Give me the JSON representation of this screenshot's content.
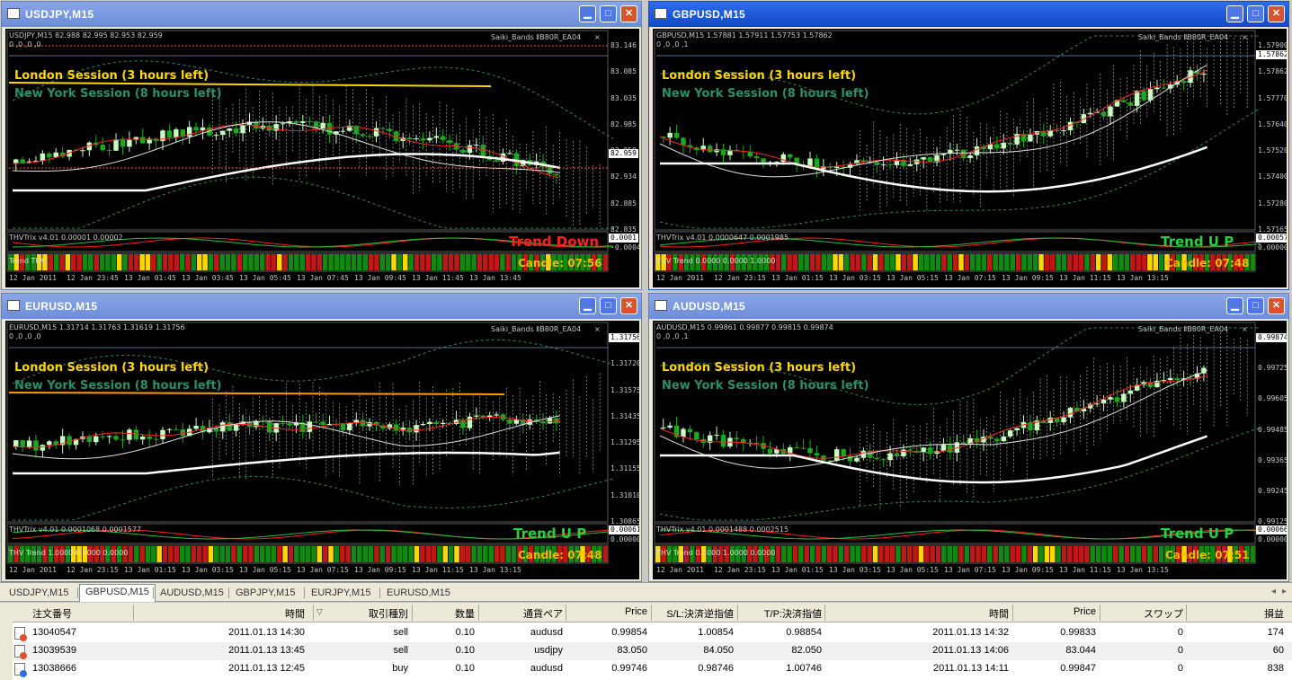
{
  "windows": [
    {
      "id": "usdjpy",
      "title": "USDJPY,M15",
      "active": false,
      "header": "USDJPY,M15  82.988 82.995 82.953 82.959",
      "sub": "0 ,0 ,0 ,0",
      "indicator": "Saiki_Bands ⅡB80R_EA04",
      "london": "London Session (3 hours left)",
      "newyork": "New York Session (8 hours left)",
      "prices": [
        "83.146",
        "83.085",
        "83.035",
        "82.985",
        "82.959",
        "82.934",
        "82.885",
        "82.835"
      ],
      "sub_indicator": "THVTrix v4.01 0.00001 0.00002",
      "sub_prices": [
        "0.0001",
        "-0.00047"
      ],
      "trend_label": "Trend THV",
      "trend": "Trend Down",
      "trend_color": "#ff2020",
      "candle": "Candle:  07:56",
      "times": [
        "12 Jan 2011",
        "12 Jan 23:45",
        "13 Jan 01:45",
        "13 Jan 03:45",
        "13 Jan 05:45",
        "13 Jan 07:45",
        "13 Jan 09:45",
        "13 Jan 11:45",
        "13 Jan 13:45"
      ]
    },
    {
      "id": "gbpusd",
      "title": "GBPUSD,M15",
      "active": true,
      "header": "GBPUSD,M15  1.57881 1.57911 1.57753 1.57862",
      "sub": "0 ,0 ,0 ,1",
      "indicator": "Saiki_Bands ⅡB80R_EA04",
      "london": "London Session (3 hours left)",
      "newyork": "New York Session (8 hours left)",
      "prices": [
        "1.57900",
        "1.57862",
        "1.57770",
        "1.57640",
        "1.57520",
        "1.57400",
        "1.57280",
        "1.57165"
      ],
      "sub_indicator": "THVTrix v4.01 0.0000647 0.0001985",
      "sub_prices": [
        "0.00057",
        "0.00000"
      ],
      "trend_label": "THV Trend 0.0000 0.0000 1.0000",
      "trend": "Trend U P",
      "trend_color": "#28d040",
      "candle": "Candle:  07:48",
      "times": [
        "12 Jan 2011",
        "12 Jan 23:15",
        "13 Jan 01:15",
        "13 Jan 03:15",
        "13 Jan 05:15",
        "13 Jan 07:15",
        "13 Jan 09:15",
        "13 Jan 11:15",
        "13 Jan 13:15"
      ]
    },
    {
      "id": "eurusd",
      "title": "EURUSD,M15",
      "active": false,
      "header": "EURUSD,M15  1.31714 1.31763 1.31619 1.31756",
      "sub": "0 ,0 ,0 ,0",
      "indicator": "Saiki_Bands ⅡB80R_EA04",
      "london": "London Session (3 hours left)",
      "newyork": "New York Session (8 hours left)",
      "prices": [
        "1.31756",
        "1.31720",
        "1.31575",
        "1.31435",
        "1.31295",
        "1.31155",
        "1.31010",
        "1.30865"
      ],
      "sub_indicator": "THVTrix v4.01 0.0001068 0.0001577",
      "sub_prices": [
        "0.00061",
        "0.00000"
      ],
      "trend_label": "THV Trend 1.0000 0.0000 0.0000",
      "trend": "Trend U P",
      "trend_color": "#28d040",
      "candle": "Candle:  07:48",
      "times": [
        "12 Jan 2011",
        "12 Jan 23:15",
        "13 Jan 01:15",
        "13 Jan 03:15",
        "13 Jan 05:15",
        "13 Jan 07:15",
        "13 Jan 09:15",
        "13 Jan 11:15",
        "13 Jan 13:15"
      ]
    },
    {
      "id": "audusd",
      "title": "AUDUSD,M15",
      "active": false,
      "header": "AUDUSD,M15  0.99861 0.99877 0.99815 0.99874",
      "sub": "0 ,0 ,0 ,1",
      "indicator": "Saiki_Bands ⅡB80R_EA04",
      "london": "London Session (3 hours left)",
      "newyork": "New York Session (8 hours left)",
      "prices": [
        "0.99874",
        "0.99725",
        "0.99605",
        "0.99485",
        "0.99365",
        "0.99245",
        "0.99125"
      ],
      "sub_indicator": "THVTrix v4.01 0.0001488 0.0002515",
      "sub_prices": [
        "0.00066",
        "0.00000"
      ],
      "trend_label": "THV Trend 0.0000 1.0000 0.0000",
      "trend": "Trend U P",
      "trend_color": "#28d040",
      "candle": "Candle:  07:51",
      "times": [
        "12 Jan 2011",
        "12 Jan 23:15",
        "13 Jan 01:15",
        "13 Jan 03:15",
        "13 Jan 05:15",
        "13 Jan 07:15",
        "13 Jan 09:15",
        "13 Jan 11:15",
        "13 Jan 13:15"
      ]
    }
  ],
  "tabs": [
    {
      "label": "USDJPY,M15",
      "selected": false
    },
    {
      "label": "GBPUSD,M15",
      "selected": true
    },
    {
      "label": "AUDUSD,M15",
      "selected": false
    },
    {
      "label": "GBPJPY,M15",
      "selected": false
    },
    {
      "label": "EURJPY,M15",
      "selected": false
    },
    {
      "label": "EURUSD,M15",
      "selected": false
    }
  ],
  "table": {
    "headers": [
      "注文番号",
      "時間",
      "取引種別",
      "数量",
      "通貨ペア",
      "Price",
      "S/L:決済逆指値",
      "T/P:決済指値",
      "時間",
      "Price",
      "スワップ",
      "損益"
    ],
    "rows": [
      [
        "13040547",
        "2011.01.13 14:30",
        "sell",
        "0.10",
        "audusd",
        "0.99854",
        "1.00854",
        "0.98854",
        "2011.01.13 14:32",
        "0.99833",
        "0",
        "174"
      ],
      [
        "13039539",
        "2011.01.13 13:45",
        "sell",
        "0.10",
        "usdjpy",
        "83.050",
        "84.050",
        "82.050",
        "2011.01.13 14:06",
        "83.044",
        "0",
        "60"
      ],
      [
        "13038666",
        "2011.01.13 12:45",
        "buy",
        "0.10",
        "audusd",
        "0.99746",
        "0.98746",
        "1.00746",
        "2011.01.13 14:11",
        "0.99847",
        "0",
        "838"
      ]
    ]
  },
  "colors": {
    "chart_bg": "#000000",
    "bull": "#c8ffc0",
    "bear": "#1fa81f",
    "london": "#ffd700",
    "newyork": "#2a8f6a",
    "trend_up": "#28d040",
    "trend_down": "#ff2020",
    "candle_timer": "#f5b800"
  }
}
